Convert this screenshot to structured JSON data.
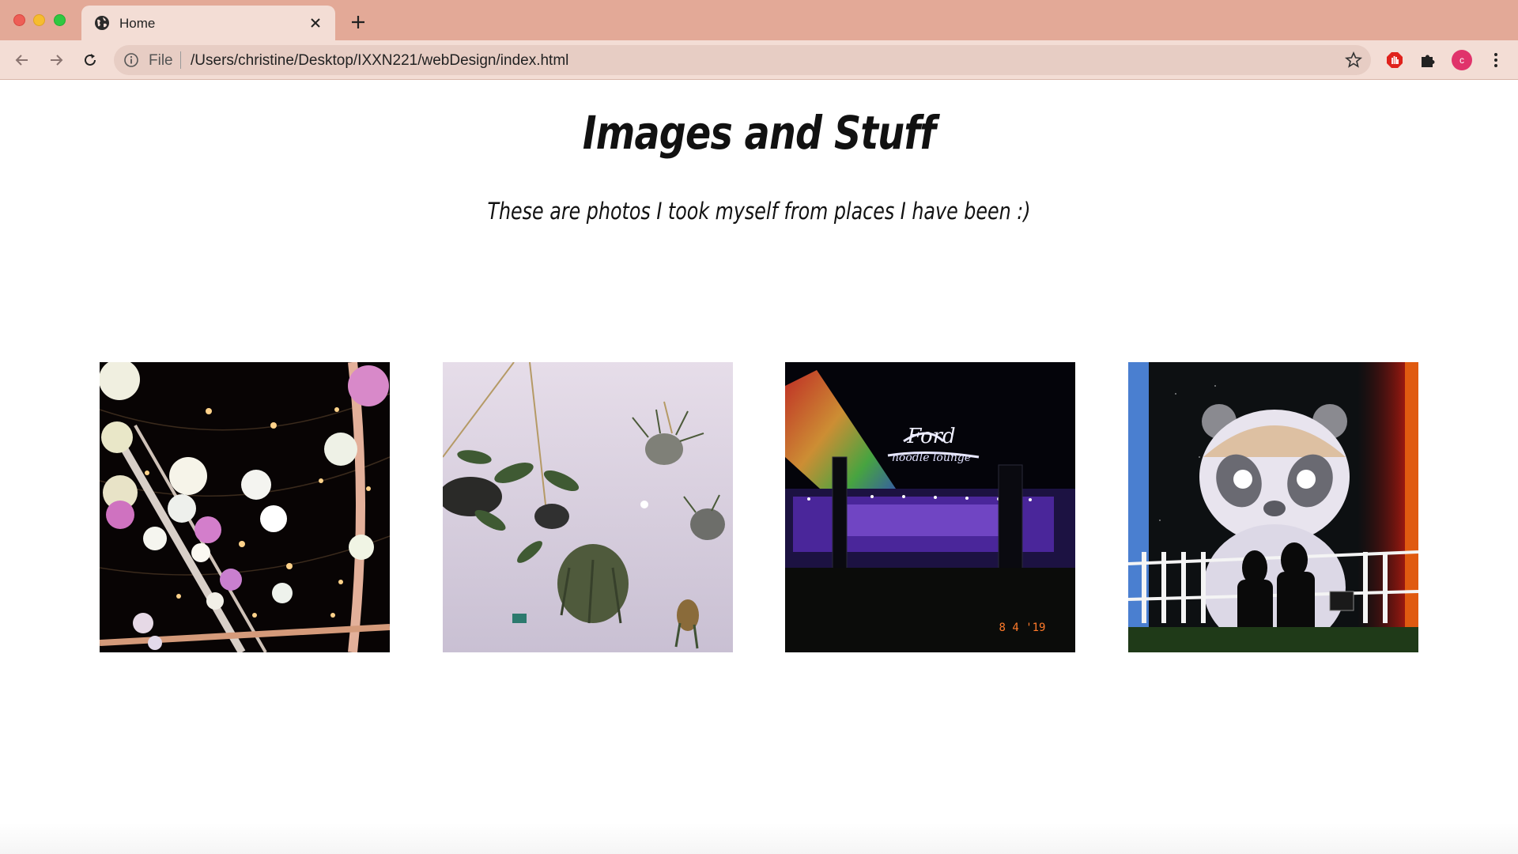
{
  "browser": {
    "tab": {
      "title": "Home",
      "icon": "globe-icon"
    },
    "address": {
      "scheme_label": "File",
      "url": "/Users/christine/Desktop/IXXN221/webDesign/index.html"
    },
    "profile_initial": "c",
    "colors": {
      "frame": "#e3a997",
      "toolbar": "#f3ddd5",
      "avatar": "#e0336b"
    }
  },
  "page": {
    "title": "Images and Stuff",
    "subtitle": "These are photos I took myself from places I have been :)",
    "photos": [
      {
        "subject": "lanterns-and-string-lights",
        "overlay_text": ""
      },
      {
        "subject": "hanging-plants",
        "overlay_text": ""
      },
      {
        "subject": "ford-noodle-lounge-neon",
        "overlay_text": "8 4 '19"
      },
      {
        "subject": "illuminated-panda",
        "overlay_text": ""
      }
    ]
  }
}
